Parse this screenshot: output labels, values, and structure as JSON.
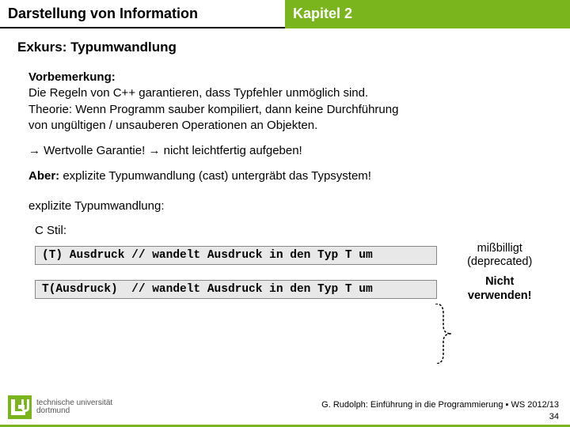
{
  "header": {
    "left": "Darstellung von Information",
    "right": "Kapitel 2"
  },
  "subtitle": "Exkurs: Typumwandlung",
  "vorbemerkung": {
    "label": "Vorbemerkung:",
    "line1": "Die Regeln von C++ garantieren, dass Typfehler unmöglich sind.",
    "line2": "Theorie: Wenn Programm sauber kompiliert, dann keine Durchführung",
    "line3": "von  ungültigen / unsauberen Operationen an Objekten."
  },
  "garantie": "→ Wertvolle Garantie! → nicht leichtfertig aufgeben!",
  "aber": {
    "label": "Aber:",
    "text": " explizite Typumwandlung (cast) untergräbt das Typsystem!"
  },
  "explicit_label": "explizite Typumwandlung:",
  "cstil": "C Stil:",
  "code1": "(T) Ausdruck // wandelt Ausdruck in den Typ T um",
  "code2": "T(Ausdruck)  // wandelt Ausdruck in den Typ T um",
  "annot1": {
    "l1": "mißbilligt",
    "l2": "(deprecated)"
  },
  "annot2": {
    "l1": "Nicht",
    "l2": "verwenden!"
  },
  "footer": {
    "line": "G. Rudolph: Einführung in die Programmierung ▪ WS 2012/13",
    "page": "34"
  },
  "logo": {
    "l1": "technische universität",
    "l2": "dortmund"
  }
}
